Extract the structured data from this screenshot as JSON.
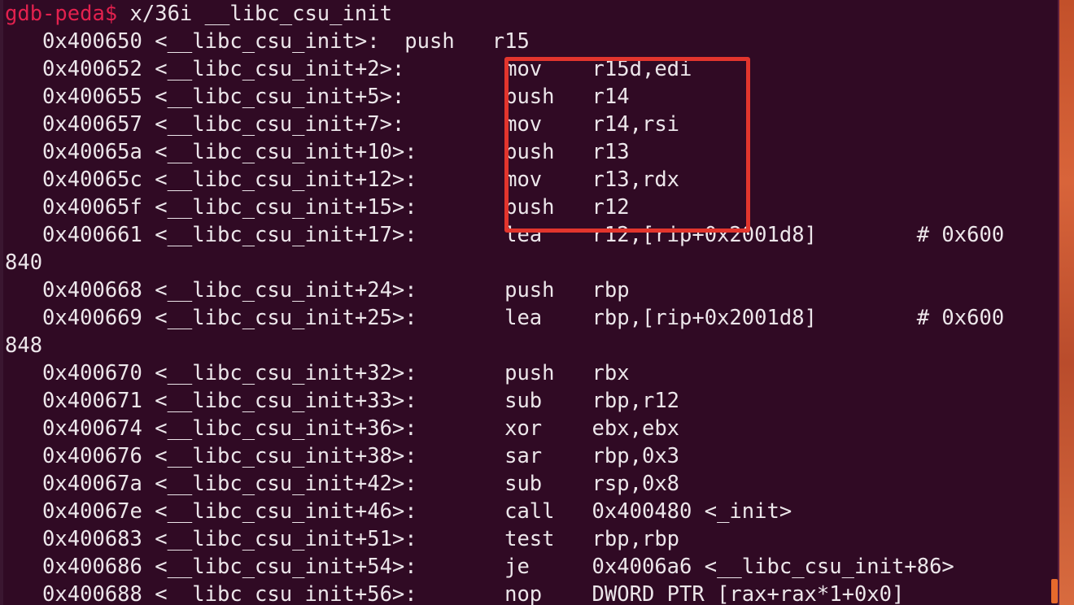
{
  "terminal": {
    "prompt": "gdb-peda$",
    "command": " x/36i __libc_csu_init",
    "output_lines": [
      "   0x400650 <__libc_csu_init>:  push   r15",
      "   0x400652 <__libc_csu_init+2>:        mov    r15d,edi",
      "   0x400655 <__libc_csu_init+5>:        push   r14",
      "   0x400657 <__libc_csu_init+7>:        mov    r14,rsi",
      "   0x40065a <__libc_csu_init+10>:       push   r13",
      "   0x40065c <__libc_csu_init+12>:       mov    r13,rdx",
      "   0x40065f <__libc_csu_init+15>:       push   r12",
      "   0x400661 <__libc_csu_init+17>:       lea    r12,[rip+0x2001d8]        # 0x600",
      "840",
      "   0x400668 <__libc_csu_init+24>:       push   rbp",
      "   0x400669 <__libc_csu_init+25>:       lea    rbp,[rip+0x2001d8]        # 0x600",
      "848",
      "   0x400670 <__libc_csu_init+32>:       push   rbx",
      "   0x400671 <__libc_csu_init+33>:       sub    rbp,r12",
      "   0x400674 <__libc_csu_init+36>:       xor    ebx,ebx",
      "   0x400676 <__libc_csu_init+38>:       sar    rbp,0x3",
      "   0x40067a <__libc_csu_init+42>:       sub    rsp,0x8",
      "   0x40067e <__libc_csu_init+46>:       call   0x400480 <_init>",
      "   0x400683 <__libc_csu_init+51>:       test   rbp,rbp",
      "   0x400686 <__libc_csu_init+54>:       je     0x4006a6 <__libc_csu_init+86>",
      "   0x400688 <__libc_csu_init+56>:       nop    DWORD PTR [rax+rax*1+0x0]"
    ]
  },
  "colors": {
    "background": "#300a24",
    "text": "#ece6ea",
    "prompt": "#e2214e",
    "highlight_box": "#e2352d",
    "side_panel": "#d8643a"
  }
}
